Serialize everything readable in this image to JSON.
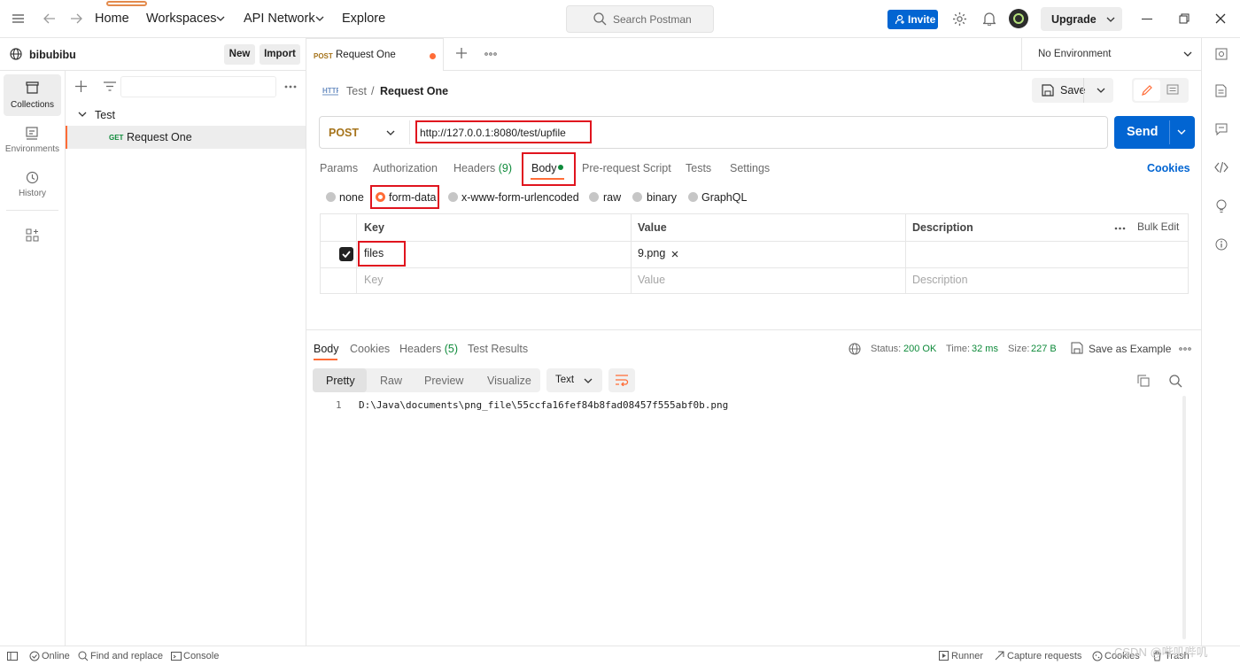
{
  "topbar": {
    "nav": [
      "Home",
      "Workspaces",
      "API Network",
      "Explore"
    ],
    "search_placeholder": "Search Postman",
    "invite": "Invite",
    "upgrade": "Upgrade"
  },
  "workspace": {
    "name": "bibubibu",
    "new_btn": "New",
    "import_btn": "Import"
  },
  "rail": [
    "Collections",
    "Environments",
    "History"
  ],
  "collections": {
    "folder": "Test",
    "request_method": "GET",
    "request_name": "Request One"
  },
  "tab": {
    "method": "POST",
    "name": "Request One"
  },
  "environment": "No Environment",
  "breadcrumb": {
    "parent": "Test",
    "separator": "/",
    "current": "Request One"
  },
  "save": "Save",
  "request": {
    "method": "POST",
    "url": "http://127.0.0.1:8080/test/upfile",
    "send": "Send"
  },
  "req_tabs": {
    "params": "Params",
    "authorization": "Authorization",
    "headers": "Headers",
    "headers_count": "(9)",
    "body": "Body",
    "prerequest": "Pre-request Script",
    "tests": "Tests",
    "settings": "Settings",
    "cookies": "Cookies"
  },
  "body_types": [
    "none",
    "form-data",
    "x-www-form-urlencoded",
    "raw",
    "binary",
    "GraphQL"
  ],
  "table": {
    "headers": [
      "Key",
      "Value",
      "Description"
    ],
    "bulk_edit": "Bulk Edit",
    "rows": [
      {
        "key": "files",
        "value": "9.png",
        "description": ""
      }
    ],
    "placeholder": {
      "key": "Key",
      "value": "Value",
      "description": "Description"
    }
  },
  "response": {
    "tabs": {
      "body": "Body",
      "cookies": "Cookies",
      "headers": "Headers",
      "headers_count": "(5)",
      "test_results": "Test Results"
    },
    "status_label": "Status:",
    "status_value": "200 OK",
    "time_label": "Time:",
    "time_value": "32 ms",
    "size_label": "Size:",
    "size_value": "227 B",
    "save_example": "Save as Example",
    "view_modes": [
      "Pretty",
      "Raw",
      "Preview",
      "Visualize"
    ],
    "format": "Text",
    "line_number": "1",
    "line_content": "D:\\Java\\documents\\png_file\\55ccfa16fef84b8fad08457f555abf0b.png"
  },
  "statusbar": {
    "online": "Online",
    "find_replace": "Find and replace",
    "console": "Console",
    "runner": "Runner",
    "capture": "Capture requests",
    "cookies": "Cookies",
    "trash": "Trash",
    "watermark": "CSDN @哔叽哔叽"
  },
  "colors": {
    "accent": "#0265d2",
    "highlight": "#e0141e",
    "orange": "#ff6c37",
    "status_green": "#0e8a3a"
  }
}
